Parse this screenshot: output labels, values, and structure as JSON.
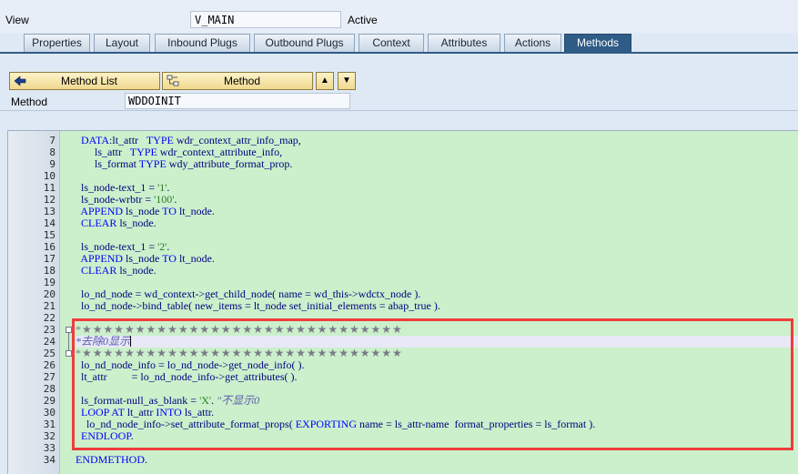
{
  "header": {
    "view_label": "View",
    "view_value": "V_MAIN",
    "status": "Active"
  },
  "tabs": [
    {
      "label": "Properties",
      "active": false
    },
    {
      "label": "Layout",
      "active": false
    },
    {
      "label": "Inbound Plugs",
      "active": false
    },
    {
      "label": "Outbound Plugs",
      "active": false
    },
    {
      "label": "Context",
      "active": false
    },
    {
      "label": "Attributes",
      "active": false
    },
    {
      "label": "Actions",
      "active": false
    },
    {
      "label": "Methods",
      "active": true
    }
  ],
  "toolbar": {
    "method_list_label": "Method List",
    "method_label": "Method",
    "method_list_icon": "back-arrow-icon",
    "method_icon": "method-tree-icon",
    "up_icon": "arrow-up-icon",
    "down_icon": "arrow-down-icon"
  },
  "method": {
    "label": "Method",
    "value": "WDDOINIT"
  },
  "editor": {
    "lines": [
      {
        "n": "7",
        "html": "  <span class=\"kw\">DATA</span>:lt_attr   <span class=\"kw\">TYPE</span> wdr_context_attr_info_map,"
      },
      {
        "n": "8",
        "html": "       ls_attr   <span class=\"kw\">TYPE</span> wdr_context_attribute_info,"
      },
      {
        "n": "9",
        "html": "       ls_format <span class=\"kw\">TYPE</span> wdy_attribute_format_prop."
      },
      {
        "n": "10",
        "html": ""
      },
      {
        "n": "11",
        "html": "  ls_node-text_1 = <span class=\"str\">'1'</span>."
      },
      {
        "n": "12",
        "html": "  ls_node-wrbtr = <span class=\"str\">'100'</span>."
      },
      {
        "n": "13",
        "html": "  <span class=\"kw\">APPEND</span> ls_node <span class=\"kw\">TO</span> lt_node."
      },
      {
        "n": "14",
        "html": "  <span class=\"kw\">CLEAR</span> ls_node."
      },
      {
        "n": "15",
        "html": ""
      },
      {
        "n": "16",
        "html": "  ls_node-text_1 = <span class=\"str\">'2'</span>."
      },
      {
        "n": "17",
        "html": "  <span class=\"kw\">APPEND</span> ls_node <span class=\"kw\">TO</span> lt_node."
      },
      {
        "n": "18",
        "html": "  <span class=\"kw\">CLEAR</span> ls_node."
      },
      {
        "n": "19",
        "html": ""
      },
      {
        "n": "20",
        "html": "  lo_nd_node = wd_context-&gt;get_child_node( name = wd_this-&gt;wdctx_node )."
      },
      {
        "n": "21",
        "html": "  lo_nd_node-&gt;bind_table( new_items = lt_node set_initial_elements = abap_true )."
      },
      {
        "n": "22",
        "html": ""
      },
      {
        "n": "23",
        "html": "*★★★★★★★★★★★★★★★★★★★★★★★★★★★★★★",
        "cls": "stars"
      },
      {
        "n": "24",
        "html": "*去除0显示<span class=\"caret\"></span>",
        "cls": "comment cur"
      },
      {
        "n": "25",
        "html": "*★★★★★★★★★★★★★★★★★★★★★★★★★★★★★★",
        "cls": "stars"
      },
      {
        "n": "26",
        "html": "  lo_nd_node_info = lo_nd_node-&gt;get_node_info( )."
      },
      {
        "n": "27",
        "html": "  lt_attr         = lo_nd_node_info-&gt;get_attributes( )."
      },
      {
        "n": "28",
        "html": ""
      },
      {
        "n": "29",
        "html": "  ls_format-null_as_blank = <span class=\"str\">'X'</span>. <span class=\"cmt\">\"不显示0</span>"
      },
      {
        "n": "30",
        "html": "  <span class=\"kw\">LOOP AT</span> lt_attr <span class=\"kw\">INTO</span> ls_attr."
      },
      {
        "n": "31",
        "html": "    lo_nd_node_info-&gt;set_attribute_format_props( <span class=\"kw\">EXPORTING</span> name = ls_attr-name  format_properties = ls_format )."
      },
      {
        "n": "32",
        "html": "  <span class=\"kw\">ENDLOOP</span>."
      },
      {
        "n": "33",
        "html": ""
      },
      {
        "n": "34",
        "html": "<span class=\"kw\">ENDMETHOD</span>."
      }
    ]
  }
}
